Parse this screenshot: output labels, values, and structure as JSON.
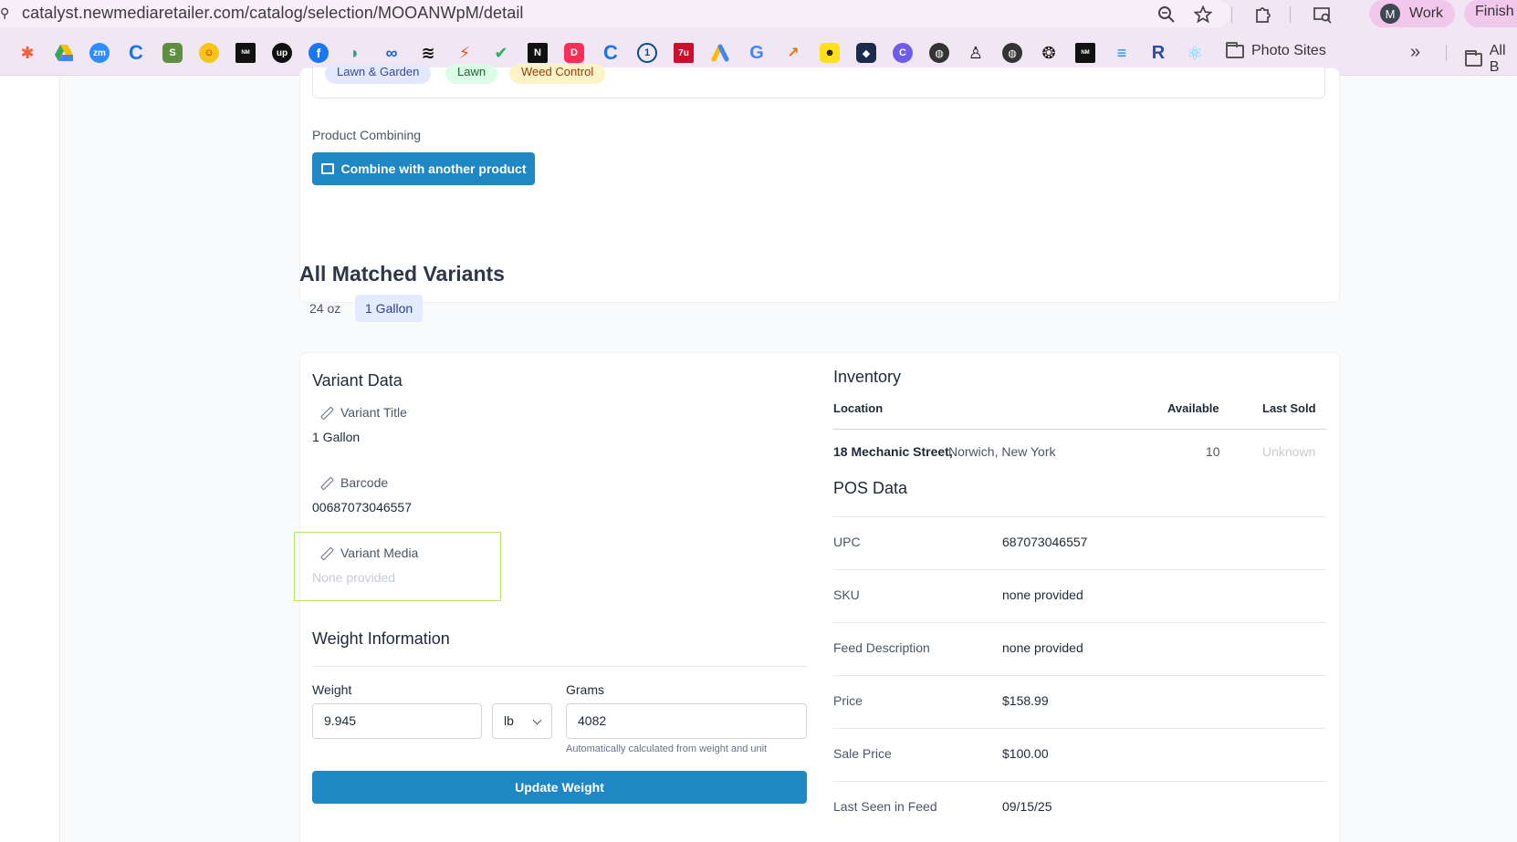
{
  "browser": {
    "url": "catalyst.newmediaretailer.com/catalog/selection/MOOANWpM/detail",
    "profile_initial": "M",
    "profile_label": "Work",
    "finish_label": "Finish u",
    "bookmarks": {
      "folder_photo_sites": "Photo Sites",
      "folder_all": "All B"
    }
  },
  "tags": [
    "Lawn & Garden",
    "Lawn",
    "Weed Control"
  ],
  "product_combining": {
    "label": "Product Combining",
    "button_label": "Combine with another product"
  },
  "variants": {
    "title": "All Matched Variants",
    "tabs": [
      "24 oz",
      "1 Gallon"
    ],
    "active_tab": "1 Gallon"
  },
  "variant_data": {
    "title": "Variant Data",
    "variant_title_label": "Variant Title",
    "variant_title_value": "1 Gallon",
    "barcode_label": "Barcode",
    "barcode_value": "00687073046557",
    "media_label": "Variant Media",
    "media_value": "None provided"
  },
  "weight": {
    "title": "Weight Information",
    "weight_label": "Weight",
    "weight_value": "9.945",
    "unit_value": "lb",
    "grams_label": "Grams",
    "grams_value": "4082",
    "hint": "Automatically calculated from weight and unit",
    "button_label": "Update Weight"
  },
  "inventory": {
    "title": "Inventory",
    "headers": {
      "location": "Location",
      "available": "Available",
      "last_sold": "Last Sold"
    },
    "rows": [
      {
        "street": "18 Mechanic Street,",
        "city": "Norwich, New York",
        "available": "10",
        "last_sold": "Unknown"
      }
    ]
  },
  "pos": {
    "title": "POS Data",
    "rows": [
      {
        "label": "UPC",
        "value": "687073046557"
      },
      {
        "label": "SKU",
        "value": "none provided"
      },
      {
        "label": "Feed Description",
        "value": "none provided"
      },
      {
        "label": "Price",
        "value": "$158.99"
      },
      {
        "label": "Sale Price",
        "value": "$100.00"
      },
      {
        "label": "Last Seen in Feed",
        "value": "09/15/25"
      }
    ]
  }
}
